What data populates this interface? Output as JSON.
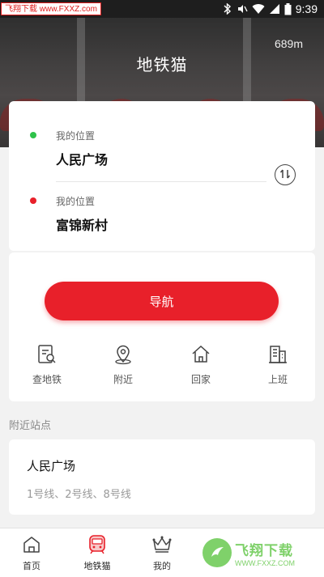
{
  "status_bar": {
    "watermark_text": "飞翔下载 www.FXXZ.com",
    "time": "9:39"
  },
  "header": {
    "title": "地铁猫",
    "distance": "689m"
  },
  "route": {
    "start": {
      "label": "我的位置",
      "name": "人民广场",
      "dot_color": "#2ec24a"
    },
    "end": {
      "label": "我的位置",
      "name": "富锦新村",
      "dot_color": "#e8202a"
    }
  },
  "nav": {
    "button_label": "导航",
    "accent": "#e8202a",
    "shortcuts": [
      {
        "label": "查地铁",
        "icon": "search-subway-icon"
      },
      {
        "label": "附近",
        "icon": "location-pin-icon"
      },
      {
        "label": "回家",
        "icon": "home-icon"
      },
      {
        "label": "上班",
        "icon": "office-building-icon"
      }
    ]
  },
  "nearby": {
    "section_title": "附近站点",
    "stations": [
      {
        "name": "人民广场",
        "lines": "1号线、2号线、8号线"
      }
    ]
  },
  "tabs": [
    {
      "label": "首页",
      "icon": "home-icon"
    },
    {
      "label": "地铁猫",
      "icon": "train-icon",
      "active": true
    },
    {
      "label": "我的",
      "icon": "crown-icon"
    }
  ],
  "watermark_logo": {
    "main": "飞翔下载",
    "sub": "WWW.FXXZ.COM"
  }
}
